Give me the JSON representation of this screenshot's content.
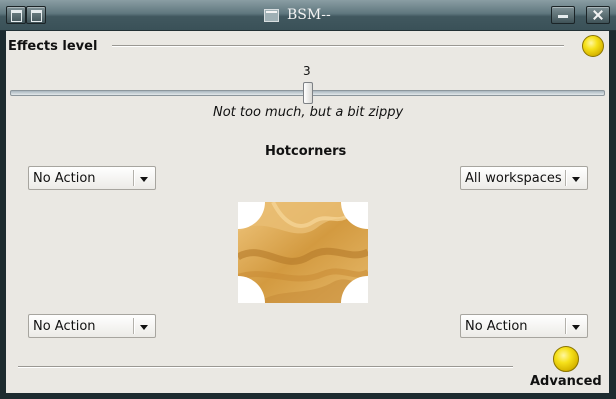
{
  "window": {
    "title": "BSM--"
  },
  "effects": {
    "label": "Effects level",
    "slider_value": "3",
    "slider_level_fraction": 0.5,
    "caption": "Not too much, but a bit zippy"
  },
  "hotcorners": {
    "heading": "Hotcorners",
    "top_left": "No Action",
    "top_right": "All workspaces",
    "bottom_left": "No Action",
    "bottom_right": "No Action"
  },
  "footer": {
    "advanced_label": "Advanced"
  },
  "colors": {
    "titlebar": "#5f777e",
    "client_bg": "#eae8e3",
    "bulb_yellow": "#f6e11a",
    "preview_gold": "#d6a24a"
  },
  "icons": [
    "window-menu-icon",
    "shade-icon",
    "app-icon",
    "minimize-icon",
    "maximize-icon",
    "close-icon",
    "bulb-icon"
  ]
}
